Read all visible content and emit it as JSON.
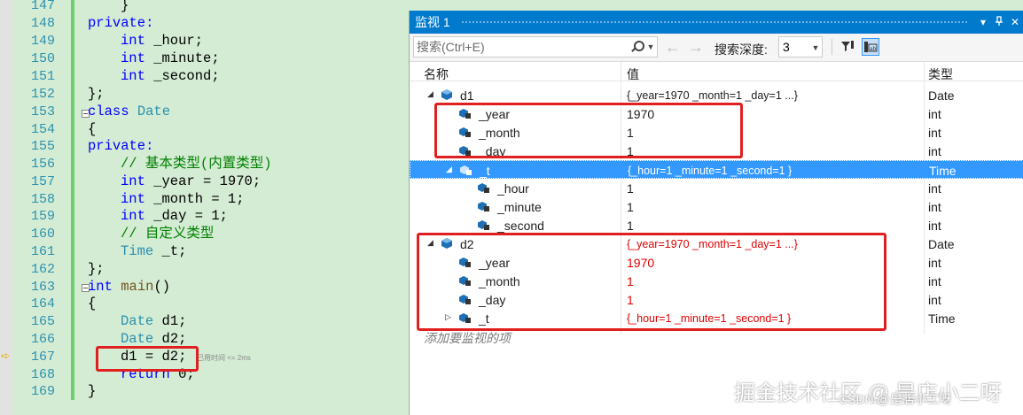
{
  "editor": {
    "line_numbers": [
      "147",
      "148",
      "149",
      "150",
      "151",
      "152",
      "153",
      "154",
      "155",
      "156",
      "157",
      "158",
      "159",
      "160",
      "161",
      "162",
      "163",
      "164",
      "165",
      "166",
      "167",
      "168",
      "169"
    ],
    "lines": {
      "l147": "}",
      "l148": "private:",
      "l149_kw": "int",
      "l149_rest": " _hour;",
      "l150_kw": "int",
      "l150_rest": " _minute;",
      "l151_kw": "int",
      "l151_rest": " _second;",
      "l152": "};",
      "l153_kw": "class",
      "l153_ty": "Date",
      "l154": "{",
      "l155": "private:",
      "l156": "// 基本类型(内置类型)",
      "l157_kw": "int",
      "l157_rest": " _year = 1970;",
      "l158_kw": "int",
      "l158_rest": " _month = 1;",
      "l159_kw": "int",
      "l159_rest": " _day = 1;",
      "l160": "// 自定义类型",
      "l161_ty": "Time",
      "l161_rest": " _t;",
      "l162": "};",
      "l163_kw": "int",
      "l163_fn": "main",
      "l163_rest": "()",
      "l164": "{",
      "l165_ty": "Date",
      "l165_rest": " d1;",
      "l166_ty": "Date",
      "l166_rest": " d2;",
      "l167": "d1 = d2;",
      "l168_kw": "return",
      "l168_rest": " 0;",
      "l169": "}"
    },
    "perf_tip": "已用时间 <= 2ms"
  },
  "watch": {
    "title": "监视 1",
    "pin_icon": "▾",
    "close_icon": "✕",
    "search_placeholder": "搜索(Ctrl+E)",
    "nav_back": "←",
    "nav_fwd": "→",
    "depth_label": "搜索深度:",
    "depth_value": "3",
    "columns": {
      "name": "名称",
      "value": "值",
      "type": "类型"
    },
    "rows": [
      {
        "name": "d1",
        "value": "{_year=1970 _month=1 _day=1 ...}",
        "type": "Date"
      },
      {
        "name": "_year",
        "value": "1970",
        "type": "int"
      },
      {
        "name": "_month",
        "value": "1",
        "type": "int"
      },
      {
        "name": "_day",
        "value": "1",
        "type": "int"
      },
      {
        "name": "_t",
        "value": "{_hour=1 _minute=1 _second=1 }",
        "type": "Time"
      },
      {
        "name": "_hour",
        "value": "1",
        "type": "int"
      },
      {
        "name": "_minute",
        "value": "1",
        "type": "int"
      },
      {
        "name": "_second",
        "value": "1",
        "type": "int"
      },
      {
        "name": "d2",
        "value": "{_year=1970 _month=1 _day=1 ...}",
        "type": "Date"
      },
      {
        "name": "_year",
        "value": "1970",
        "type": "int"
      },
      {
        "name": "_month",
        "value": "1",
        "type": "int"
      },
      {
        "name": "_day",
        "value": "1",
        "type": "int"
      },
      {
        "name": "_t",
        "value": "{_hour=1 _minute=1 _second=1 }",
        "type": "Time"
      }
    ],
    "add_watch_hint": "添加要监视的项"
  },
  "watermark": "掘金技术社区 @ 是店小二呀",
  "watermark_small": "CSDN @是店小二呀",
  "colors": {
    "accent": "#007acc",
    "selection": "#3399ff",
    "changed_value": "#e00000",
    "annotation_box": "#e02020",
    "editor_bg": "#d4ecd4"
  }
}
